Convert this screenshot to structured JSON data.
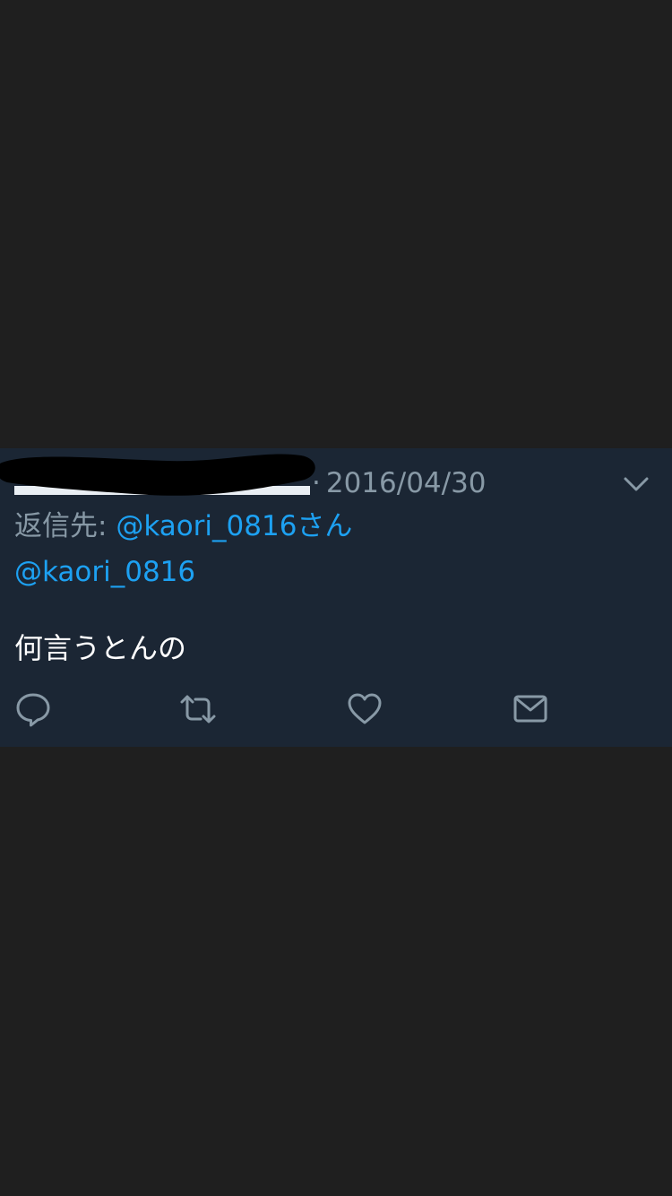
{
  "tweet": {
    "separator": "·",
    "timestamp": "2016/04/30",
    "reply_prefix": "返信先: ",
    "reply_mention": "@kaori_0816さん",
    "body_mention": "@kaori_0816",
    "body_text": "何言うとんの"
  },
  "colors": {
    "page_background": "#1f1f1f",
    "tweet_background": "#1b2634",
    "secondary_text": "#8899a6",
    "link_blue": "#1da1f2",
    "primary_text": "#ffffff"
  },
  "icons": {
    "more_options": "chevron-down-icon",
    "reply": "comment-bubble-icon",
    "retweet": "retweet-icon",
    "like": "heart-icon",
    "direct_message": "envelope-icon"
  }
}
